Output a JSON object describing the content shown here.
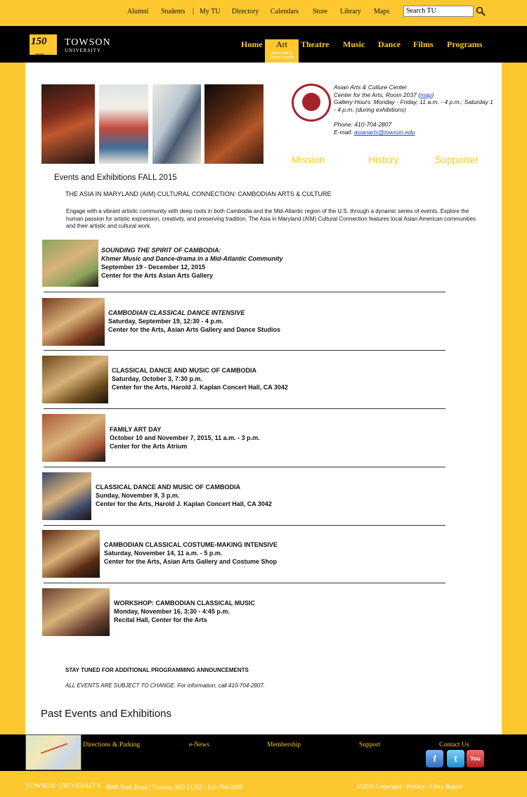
{
  "utility_nav": {
    "links": [
      "Alumni",
      "Students",
      "My TU",
      "Directory",
      "Calendars",
      "Store",
      "Library",
      "Maps"
    ],
    "search_value": "Search TU"
  },
  "header": {
    "logo_badge": "150",
    "logo_badge_sub": "years",
    "logo_name": "TOWSON",
    "logo_sub": "UNIVERSITY",
    "nav": [
      "Home",
      "Art",
      "Theatre",
      "Music",
      "Dance",
      "Films",
      "Programs"
    ],
    "active_sub": "Asian Arts & Culture Center"
  },
  "center_info": {
    "name": "Asian Arts & Culture Center",
    "address_prefix": "Center for the Arts, Room 2037 (",
    "map_link": "map",
    "address_suffix": ")",
    "hours": "Gallery Hours: Monday - Friday, 11 a.m. - 4 p.m.; Saturday 1 - 4 p.m. (during exhibitions)",
    "phone": "Phone: 410-704-2807",
    "email_label": "E-mail: ",
    "email": "asianarts@towson.edu"
  },
  "tabs": [
    "Mission",
    "History",
    "Supporter"
  ],
  "events_title": "Events and Exhibitions FALL 2015",
  "subtitle": "THE ASIA IN MARYLAND (AIM) CULTURAL CONNECTION: CAMBODIAN ARTS & CULTURE",
  "intro": "Engage with a vibrant artistic community with deep roots in both Cambodia and the Mid-Atlantic region of the U.S. through a dynamic series of events. Explore the human passion for artistic expression, creativity, and preserving tradition. The Asia in Maryland (AIM) Cultural Connection features local Asian American communities and their artistic and cultural work.",
  "events": [
    {
      "title": "SOUNDING THE SPIRIT OF CAMBODIA:",
      "title2": "Khmer Music and Dance-drama in a Mid-Atlantic Community",
      "date": "September 19 - December 12, 2015",
      "place": "Center for the Arts Asian Arts Gallery",
      "color": "#8aa35c"
    },
    {
      "title": "CAMBODIAN CLASSICAL DANCE INTENSIVE",
      "date": "Saturday, September 19, 12:30 - 4 p.m.",
      "place": "Center for the Arts, Asian Arts Gallery and Dance Studios",
      "color": "#7a3a1e"
    },
    {
      "title": "CLASSICAL DANCE AND MUSIC OF CAMBODIA",
      "date": "Saturday, October 3, 7:30 p.m.",
      "place": "Center for the Arts, Harold J. Kaplan Concert Hall, CA 3042",
      "color": "#6a4a1a"
    },
    {
      "title": "FAMILY ART DAY",
      "date": "October 10 and November 7, 2015, 11 a.m. - 3 p.m.",
      "place": "Center for the Arts Atrium",
      "color": "#a85a3a"
    },
    {
      "title": "CLASSICAL DANCE AND MUSIC OF CAMBODIA",
      "date": "Sunday, November 8, 3 p.m.",
      "place": "Center for the Arts, Harold J. Kaplan Concert Hall, CA 3042",
      "color": "#3d4a6a"
    },
    {
      "title": "CAMBODIAN CLASSICAL COSTUME-MAKING INTENSIVE",
      "date": "Saturday, November 14, 11 a.m. - 5 p.m.",
      "place": "Center for the Arts, Asian Arts Gallery and Costume Shop",
      "color": "#5a2a14"
    },
    {
      "title": "WORKSHOP: CAMBODIAN CLASSICAL MUSIC",
      "date": "Monday, November 16, 3:30 - 4:45 p.m.",
      "place": "Recital Hall, Center for the Arts",
      "color": "#6a4030"
    }
  ],
  "stay_tuned": "STAY TUNED FOR ADDITIONAL PROGRAMMING ANNOUNCEMENTS",
  "change_note": "ALL EVENTS ARE SUBJECT TO CHANGE. For information, call 410-704-2807.",
  "past_events": "Past Events and Exhibitions",
  "footer": {
    "links": [
      "Directions & Parking",
      "e-News",
      "Membership",
      "Support",
      "Contact Us"
    ],
    "social": [
      "f",
      "t",
      "You Tube"
    ]
  },
  "bottom": {
    "name": "TOWSON UNIVERSITY",
    "address": "8000 York Road  |  Towson, MD 21252  |  410-704-2000",
    "copyright": "©2015 Copyright",
    "privacy": "Privacy",
    "clery": "Clery Report"
  },
  "colors": {
    "gold": "#fdc82f",
    "black": "#000000",
    "seal_red": "#a4232b",
    "link_blue": "#1a3fcf"
  }
}
